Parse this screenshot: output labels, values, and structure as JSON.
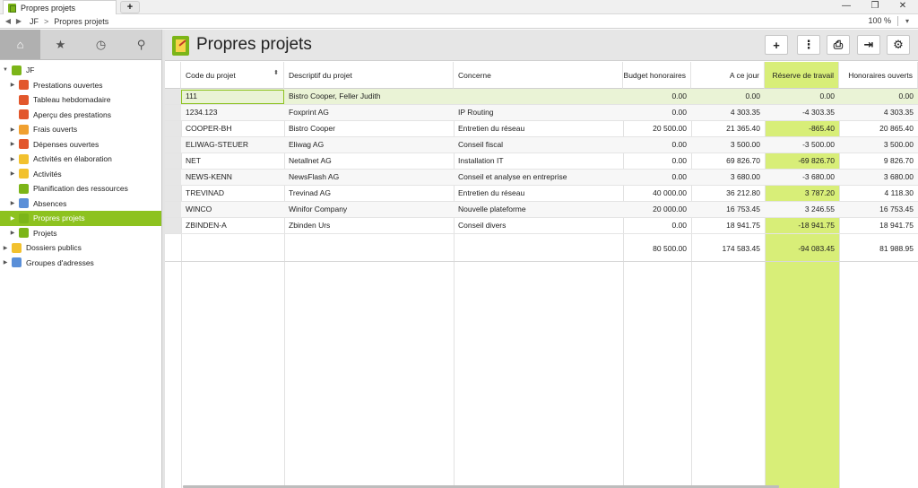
{
  "tab": {
    "label": "Propres projets",
    "add_label": "+"
  },
  "window": {
    "minimize": "—",
    "restore": "❐",
    "close": "✕"
  },
  "nav": {
    "back": "◀",
    "forward": "▶",
    "crumb_root": "JF",
    "separator": ">",
    "crumb_current": "Propres projets",
    "zoom": "100 %",
    "zoom_dropdown": "▾"
  },
  "sidebar": {
    "tabs": [
      {
        "name": "home-icon",
        "glyph": "⌂"
      },
      {
        "name": "star-icon",
        "glyph": "★"
      },
      {
        "name": "clock-icon",
        "glyph": "◷"
      },
      {
        "name": "search-icon",
        "glyph": "⚲"
      }
    ],
    "root": {
      "label": "JF",
      "icon": "user-icon"
    },
    "items": [
      {
        "label": "Prestations ouvertes",
        "expandable": true,
        "icon": "services-icon",
        "color": "#e2572c",
        "selected": false
      },
      {
        "label": "Tableau hebdomadaire",
        "expandable": false,
        "icon": "weekly-table-icon",
        "color": "#e2572c",
        "selected": false
      },
      {
        "label": "Aperçu des prestations",
        "expandable": false,
        "icon": "services-overview-icon",
        "color": "#e2572c",
        "selected": false
      },
      {
        "label": "Frais ouverts",
        "expandable": true,
        "icon": "expenses-icon",
        "color": "#f0a030",
        "selected": false
      },
      {
        "label": "Dépenses ouvertes",
        "expandable": true,
        "icon": "spending-icon",
        "color": "#e2572c",
        "selected": false
      },
      {
        "label": "Activités en élaboration",
        "expandable": true,
        "icon": "activities-draft-icon",
        "color": "#f2c12e",
        "selected": false
      },
      {
        "label": "Activités",
        "expandable": true,
        "icon": "activities-icon",
        "color": "#f2c12e",
        "selected": false
      },
      {
        "label": "Planification des ressources",
        "expandable": false,
        "icon": "resource-planning-icon",
        "color": "#7cb518",
        "selected": false
      },
      {
        "label": "Absences",
        "expandable": true,
        "icon": "absences-icon",
        "color": "#5a8fd8",
        "selected": false
      },
      {
        "label": "Propres projets",
        "expandable": true,
        "icon": "own-projects-icon",
        "color": "#7cb518",
        "selected": true
      },
      {
        "label": "Projets",
        "expandable": true,
        "icon": "projects-icon",
        "color": "#7cb518",
        "selected": false
      }
    ],
    "root_items": [
      {
        "label": "Dossiers publics",
        "expandable": true,
        "icon": "folder-icon",
        "color": "#f2c12e"
      },
      {
        "label": "Groupes d'adresses",
        "expandable": true,
        "icon": "address-groups-icon",
        "color": "#5a8fd8"
      }
    ]
  },
  "main": {
    "title": "Propres projets",
    "toolbar": [
      {
        "name": "add-button",
        "glyph": "+"
      },
      {
        "name": "more-button",
        "glyph": "⋮"
      },
      {
        "name": "print-button",
        "glyph": "⎙"
      },
      {
        "name": "export-button",
        "glyph": "⇥"
      },
      {
        "name": "settings-button",
        "glyph": "⚙"
      }
    ],
    "columns": [
      "Code du projet",
      "Descriptif du projet",
      "Concerne",
      "Budget honoraires",
      "A ce jour",
      "Réserve de travail",
      "Honoraires ouverts"
    ],
    "rows": [
      [
        "111",
        "Bistro Cooper, Feller Judith",
        "",
        "0.00",
        "0.00",
        "0.00",
        "0.00"
      ],
      [
        "1234.123",
        "Foxprint AG",
        "IP Routing",
        "0.00",
        "4 303.35",
        "-4 303.35",
        "4 303.35"
      ],
      [
        "COOPER-BH",
        "Bistro Cooper",
        "Entretien du réseau",
        "20 500.00",
        "21 365.40",
        "-865.40",
        "20 865.40"
      ],
      [
        "ELIWAG-STEUER",
        "Eliwag AG",
        "Conseil fiscal",
        "0.00",
        "3 500.00",
        "-3 500.00",
        "3 500.00"
      ],
      [
        "NET",
        "Netallnet AG",
        "Installation IT",
        "0.00",
        "69 826.70",
        "-69 826.70",
        "9 826.70"
      ],
      [
        "NEWS-KENN",
        "NewsFlash AG",
        "Conseil et analyse en entreprise",
        "0.00",
        "3 680.00",
        "-3 680.00",
        "3 680.00"
      ],
      [
        "TREVINAD",
        "Trevinad AG",
        "Entretien du réseau",
        "40 000.00",
        "36 212.80",
        "3 787.20",
        "4 118.30"
      ],
      [
        "WINCO",
        "Winifor Company",
        "Nouvelle plateforme",
        "20 000.00",
        "16 753.45",
        "3 246.55",
        "16 753.45"
      ],
      [
        "ZBINDEN-A",
        "Zbinden Urs",
        "Conseil divers",
        "0.00",
        "18 941.75",
        "-18 941.75",
        "18 941.75"
      ]
    ],
    "totals": [
      "80 500.00",
      "174 583.45",
      "-94 083.45",
      "81 988.95"
    ]
  }
}
